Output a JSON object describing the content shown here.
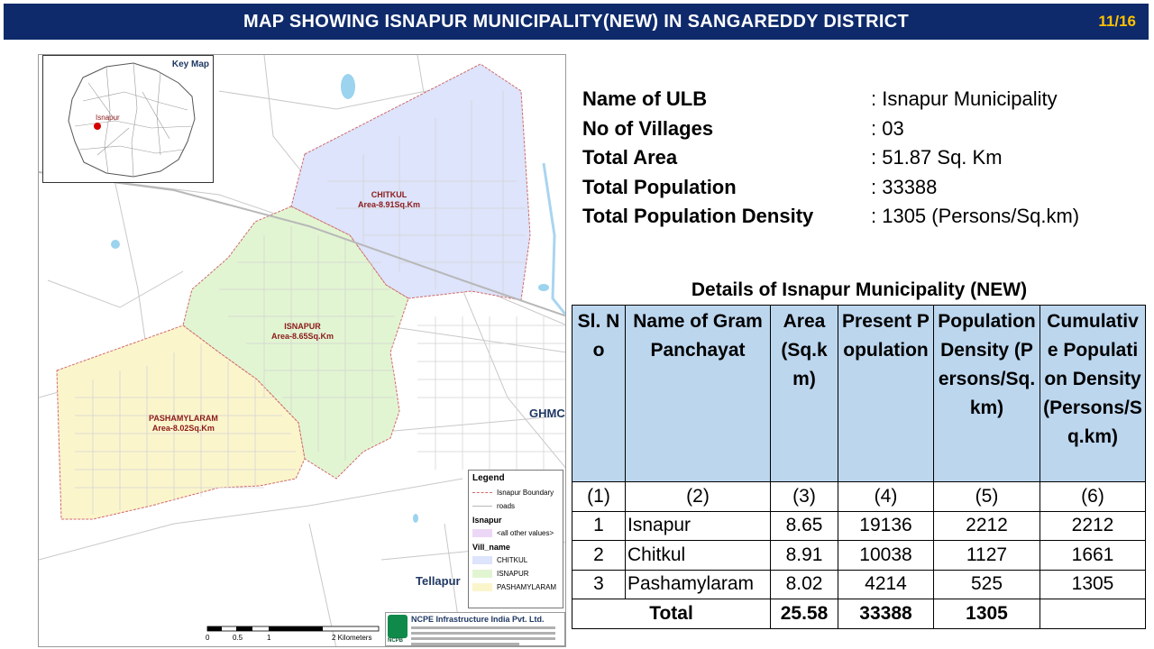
{
  "header": {
    "title": "MAP SHOWING ISNAPUR MUNICIPALITY(NEW) IN SANGAREDDY DISTRICT",
    "page": "11/16"
  },
  "map": {
    "key_map_title": "Key Map",
    "key_map_place": "Isnapur",
    "villages": [
      {
        "name": "CHITKUL",
        "area": "Area-8.91Sq.Km"
      },
      {
        "name": "ISNAPUR",
        "area": "Area-8.65Sq.Km"
      },
      {
        "name": "PASHAMYLARAM",
        "area": "Area-8.02Sq.Km"
      }
    ],
    "places": {
      "ghmc": "GHMC",
      "tellapur": "Tellapur"
    },
    "legend": {
      "title": "Legend",
      "boundary": "Isnapur Boundary",
      "roads": "roads",
      "group1": "Isnapur",
      "other": "<all other values>",
      "group2": "Vill_name",
      "items": [
        "CHITKUL",
        "ISNAPUR",
        "PASHAMYLARAM"
      ]
    },
    "scale": {
      "ticks": [
        "0",
        "0.5",
        "1",
        "2 Kilometers"
      ]
    },
    "logo": {
      "company": "NCPE Infrastructure India Pvt. Ltd.",
      "mark": "NCPB"
    },
    "colors": {
      "chitkul": "#dde4fb",
      "isnapur": "#e2f5d2",
      "pashamylaram": "#fbf5cc",
      "boundary": "#d06a6a",
      "other": "#ecd8f6"
    }
  },
  "info": [
    {
      "label": "Name of ULB",
      "value": ": Isnapur Municipality"
    },
    {
      "label": "No of Villages",
      "value": ": 03"
    },
    {
      "label": "Total Area",
      "value": ": 51.87 Sq. Km"
    },
    {
      "label": "Total Population",
      "value": ": 33388"
    },
    {
      "label": "Total Population Density",
      "value": ": 1305 (Persons/Sq.km)"
    }
  ],
  "table": {
    "caption": "Details of Isnapur Municipality (NEW)",
    "headers": [
      "Sl. No",
      "Name of Gram Panchayat",
      "Area (Sq.km)",
      "Present Population",
      "Population Density (Persons/Sq.km)",
      "Cumulative Population Density (Persons/Sq.km)"
    ],
    "col_numbers": [
      "(1)",
      "(2)",
      "(3)",
      "(4)",
      "(5)",
      "(6)"
    ],
    "rows": [
      [
        "1",
        "Isnapur",
        "8.65",
        "19136",
        "2212",
        "2212"
      ],
      [
        "2",
        "Chitkul",
        "8.91",
        "10038",
        "1127",
        "1661"
      ],
      [
        "3",
        "Pashamylaram",
        "8.02",
        "4214",
        "525",
        "1305"
      ]
    ],
    "total": [
      "Total",
      "25.58",
      "33388",
      "1305",
      ""
    ]
  }
}
